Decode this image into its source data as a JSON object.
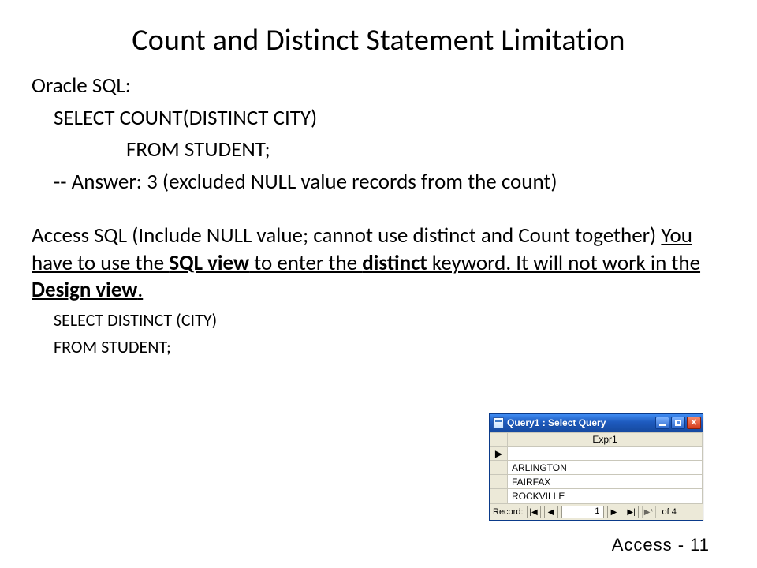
{
  "title": "Count and Distinct Statement Limitation",
  "oracle": {
    "label": "Oracle SQL:",
    "line1": "SELECT COUNT(DISTINCT   CITY)",
    "line2": "FROM STUDENT;",
    "answer": "-- Answer: 3 (excluded NULL value records from the count)"
  },
  "access": {
    "intro_pre": "Access SQL (Include NULL value; cannot use distinct and Count together)  ",
    "note_part1": "You have to use the ",
    "note_bold1": "SQL view",
    "note_part2": " to enter the ",
    "note_bold2": "distinct",
    "note_part3": " keyword.  It will not work in the ",
    "note_bold3": "Design view",
    "note_part4": ".",
    "sql1": "SELECT DISTINCT (CITY)",
    "sql2": "FROM STUDENT;"
  },
  "window": {
    "title": "Query1 : Select Query",
    "column_header": "Expr1",
    "rows": [
      "",
      "ARLINGTON",
      "FAIRFAX",
      "ROCKVILLE"
    ],
    "pointer_glyph": "▶",
    "nav": {
      "label": "Record:",
      "first": "|◀",
      "prev": "◀",
      "value": "1",
      "next": "▶",
      "last": "▶|",
      "new": "▶*",
      "of_text": "of  4"
    }
  },
  "footer": "Access   -   11"
}
